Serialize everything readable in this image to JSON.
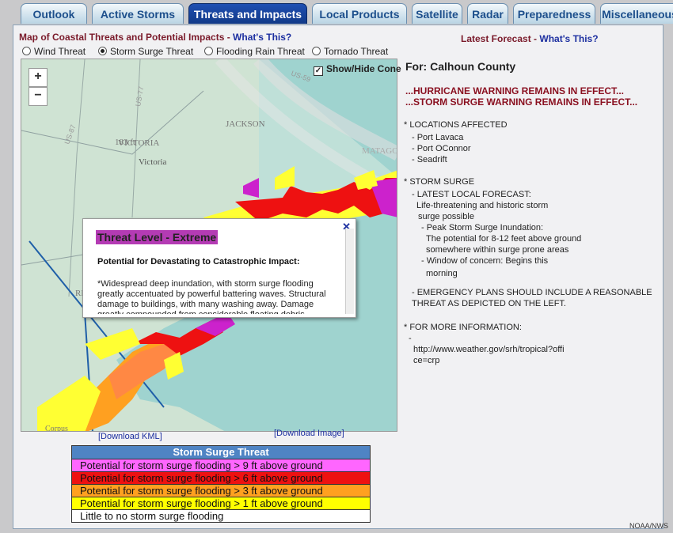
{
  "tabs": [
    {
      "label": "Outlook"
    },
    {
      "label": "Active Storms"
    },
    {
      "label": "Threats and Impacts"
    },
    {
      "label": "Local Products"
    },
    {
      "label": "Satellite"
    },
    {
      "label": "Radar"
    },
    {
      "label": "Preparedness"
    },
    {
      "label": "Miscellaneous"
    }
  ],
  "map_header": {
    "title": "Map of Coastal Threats and Potential Impacts - ",
    "whats_this": "What's This?"
  },
  "latest": {
    "label": "Latest Forecast - ",
    "whats_this": "What's This?"
  },
  "threat_options": [
    {
      "label": "Wind Threat"
    },
    {
      "label": "Storm Surge Threat",
      "selected": true
    },
    {
      "label": "Flooding Rain Threat"
    },
    {
      "label": "Tornado Threat"
    }
  ],
  "map": {
    "zoom_in": "+",
    "zoom_out": "−",
    "show_cone": "Show/Hide Cone",
    "labels": {
      "victoria_county": "VICTORIA",
      "victoria": "Victoria",
      "jackson": "JACKSON",
      "matagorda": "MATAGO",
      "elev": "183 ft",
      "corpus": "Corpus",
      "re": "RE"
    }
  },
  "popup": {
    "title": "Threat Level - Extreme",
    "subtitle": "Potential for Devastating to Catastrophic Impact:",
    "body": "*Widespread deep inundation, with storm surge flooding greatly accentuated by powerful battering waves. Structural damage to buildings, with many washing away. Damage greatly compounded from considerable floating debris."
  },
  "downloads": {
    "kml": "[Download KML]",
    "image": "[Download Image]"
  },
  "legend": {
    "title": "Storm Surge Threat",
    "rows": [
      {
        "label": "Potential for storm surge flooding > 9 ft above ground",
        "color": "#ff66ff"
      },
      {
        "label": "Potential for storm surge flooding > 6 ft above ground",
        "color": "#ee1111"
      },
      {
        "label": "Potential for storm surge flooding > 3 ft above ground",
        "color": "#ffa020"
      },
      {
        "label": "Potential for storm surge flooding > 1 ft above ground",
        "color": "#ffff00"
      },
      {
        "label": "Little to no storm surge flooding",
        "color": "#ffffff"
      }
    ]
  },
  "forecast": {
    "county": "For: Calhoun County",
    "warn1": "...HURRICANE WARNING REMAINS IN EFFECT...",
    "warn2": "...STORM SURGE WARNING REMAINS IN EFFECT...",
    "lines": [
      "* LOCATIONS AFFECTED",
      "- Port Lavaca",
      "- Port OConnor",
      "- Seadrift",
      "* STORM SURGE",
      "- LATEST LOCAL FORECAST:",
      "Life-threatening and historic storm",
      "surge possible",
      "- Peak Storm Surge Inundation:",
      "The potential for 8-12 feet above ground",
      "somewhere within surge prone areas",
      "- Window of concern: Begins this",
      "morning",
      "- EMERGENCY PLANS SHOULD INCLUDE A REASONABLE",
      "THREAT AS DEPICTED ON THE LEFT.",
      "* FOR MORE INFORMATION:",
      "-",
      "http://www.weather.gov/srh/tropical?offi",
      "ce=crp"
    ]
  },
  "credit": "NOAA/NWS"
}
